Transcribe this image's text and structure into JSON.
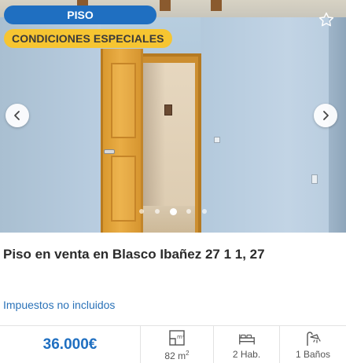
{
  "photo": {
    "badges": {
      "type": "PISO",
      "conditions": "CONDICIONES ESPECIALES"
    },
    "icons": {
      "favorite": "star-outline-icon",
      "prev": "chevron-left-icon",
      "next": "chevron-right-icon"
    },
    "carousel": {
      "total": 5,
      "active": 3
    }
  },
  "listing": {
    "title": "Piso en venta en Blasco Ibañez 27 1 1, 27",
    "tax_note": "Impuestos no incluidos"
  },
  "footer": {
    "price": "36.000€",
    "area": {
      "value": "82 m",
      "unit_sup": "2",
      "icon": "floorplan-icon"
    },
    "rooms": {
      "label": "2 Hab.",
      "icon": "bed-icon"
    },
    "baths": {
      "label": "1 Baños",
      "icon": "shower-icon"
    }
  },
  "colors": {
    "brand_blue": "#1f6fc1",
    "badge_yellow": "#f6c531",
    "link_blue": "#2a72b8"
  }
}
